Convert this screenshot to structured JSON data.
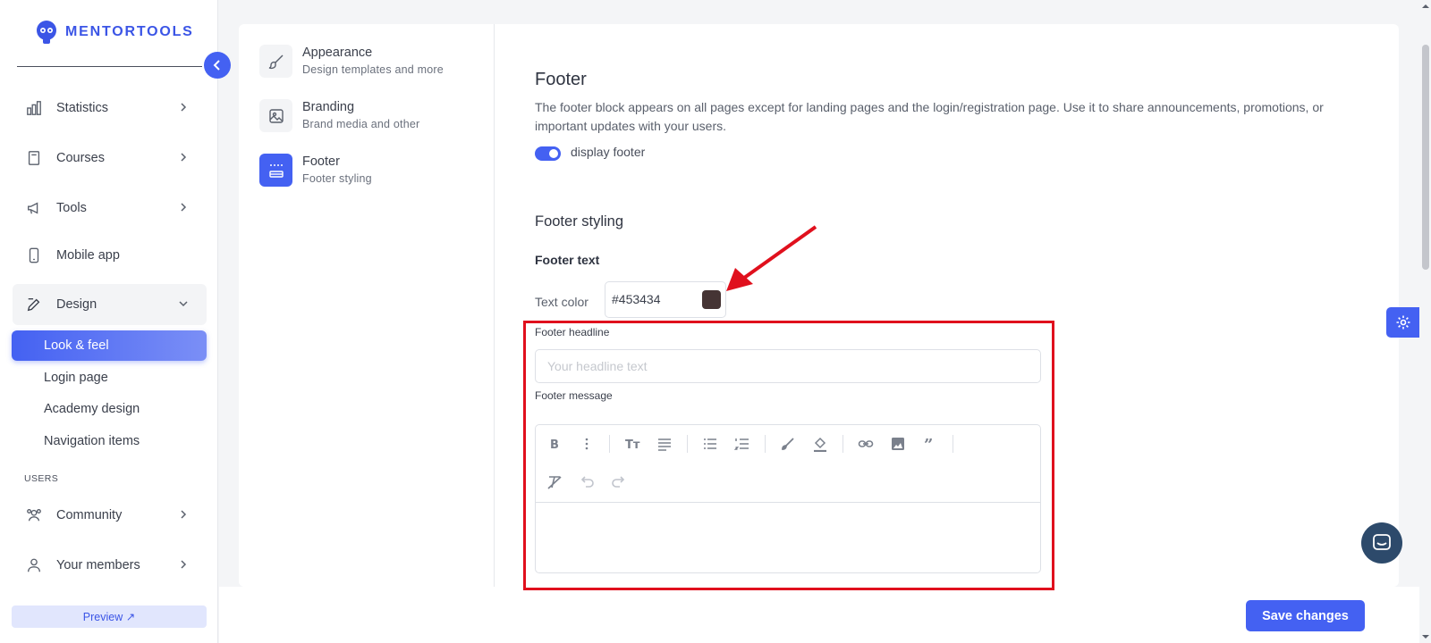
{
  "brand": {
    "name": "MENTORTOOLS",
    "color": "#3b55e6"
  },
  "sidebar": {
    "items": [
      {
        "label": "Statistics",
        "icon": "bar-chart-icon"
      },
      {
        "label": "Courses",
        "icon": "book-icon"
      },
      {
        "label": "Tools",
        "icon": "megaphone-icon"
      },
      {
        "label": "Mobile app",
        "icon": "phone-icon"
      },
      {
        "label": "Design",
        "icon": "pencil-icon"
      }
    ],
    "design_sub": [
      "Look & feel",
      "Login page",
      "Academy design",
      "Navigation items"
    ],
    "users_section": "USERS",
    "user_items": [
      {
        "label": "Community",
        "icon": "people-icon"
      },
      {
        "label": "Your members",
        "icon": "user-icon"
      }
    ],
    "preview_label": "Preview ↗"
  },
  "settings_nav": [
    {
      "title": "Appearance",
      "subtitle": "Design templates and more",
      "icon": "brush-icon"
    },
    {
      "title": "Branding",
      "subtitle": "Brand media and other",
      "icon": "image-icon"
    },
    {
      "title": "Footer",
      "subtitle": "Footer styling",
      "icon": "footer-layout-icon"
    }
  ],
  "footer": {
    "title": "Footer",
    "description": "The footer block appears on all pages except for landing pages and the login/registration page. Use it to share announcements, promotions, or important updates with your users.",
    "toggle_label": "display footer",
    "toggle_on": true,
    "styling_title": "Footer styling",
    "text_title": "Footer text",
    "text_color_label": "Text color",
    "text_color_value": "#453434",
    "headline_label": "Footer headline",
    "headline_placeholder": "Your headline text",
    "message_label": "Footer message"
  },
  "actions": {
    "save_label": "Save changes"
  },
  "colors": {
    "accent": "#4461f2",
    "annotation": "#e0101d"
  }
}
